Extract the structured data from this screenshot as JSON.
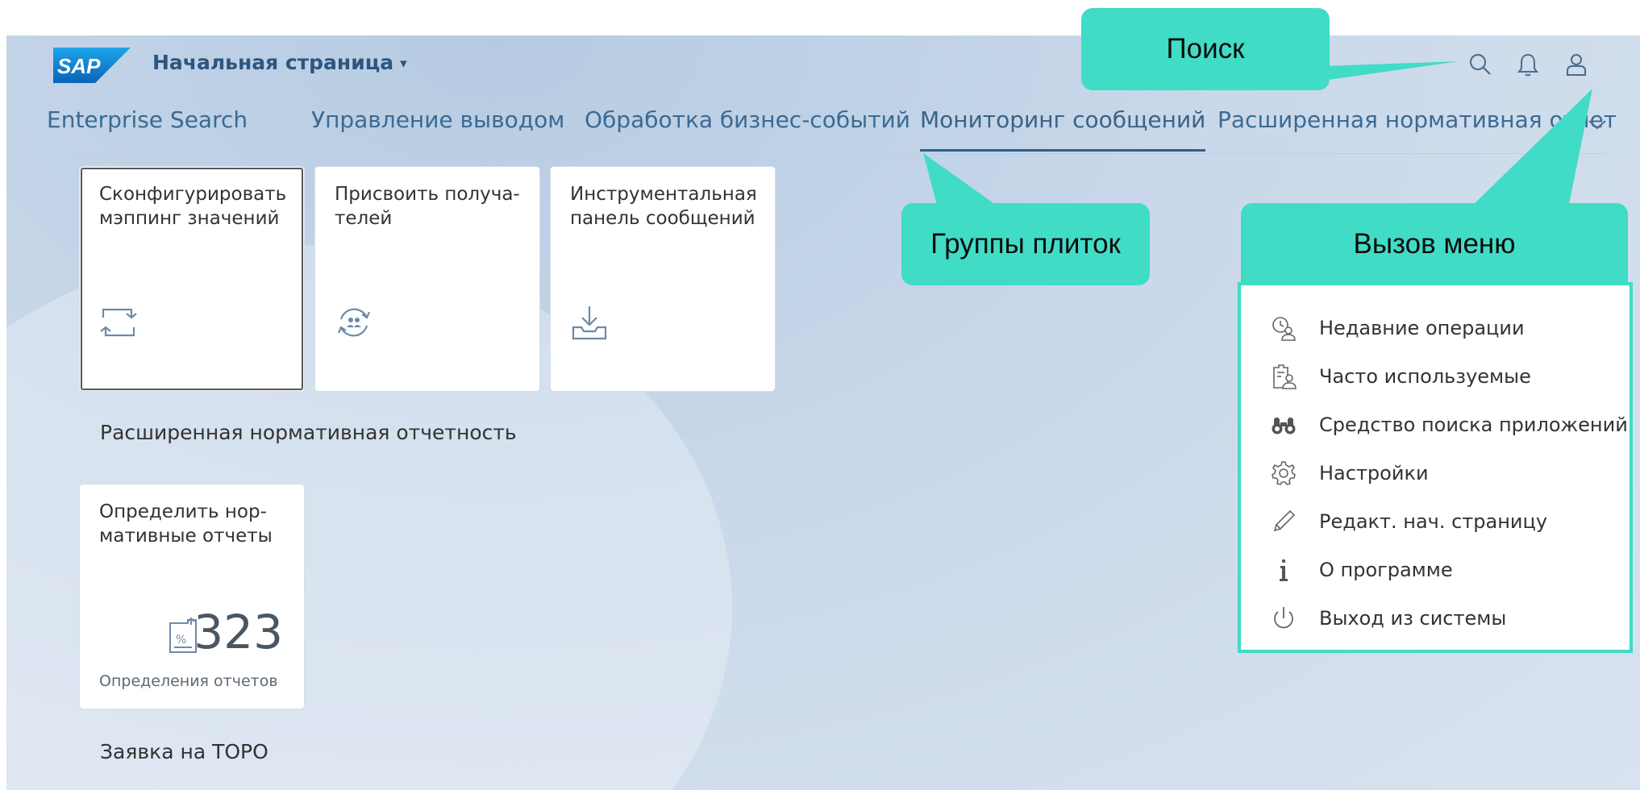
{
  "header": {
    "logo_text": "SAP",
    "title": "Начальная страница",
    "caret": "▾"
  },
  "tabs": [
    {
      "label": "Enterprise Search"
    },
    {
      "label": "Управление выводом"
    },
    {
      "label": "Обработка бизнес-событий"
    },
    {
      "label": "Мониторинг сообщений",
      "active": true
    },
    {
      "label": "Расширенная нормативная отчет"
    }
  ],
  "tiles": [
    {
      "title": "Сконфигурировать\nмэппинг значений",
      "icon": "mapping-icon"
    },
    {
      "title": "Присвоить получа-\nтелей",
      "icon": "assign-recipients-icon"
    },
    {
      "title": "Инструментальная\nпанель сообщений",
      "icon": "download-tray-icon"
    }
  ],
  "groups": [
    {
      "title": "Расширенная нормативная отчетность",
      "tile": {
        "title": "Определить нор-\nмативные отчеты",
        "kpi": "323",
        "footer": "Определения отчетов",
        "icon": "report-percent-icon"
      }
    },
    {
      "title": "Заявка на ТОРО"
    }
  ],
  "callouts": {
    "search": "Поиск",
    "tile_groups": "Группы плиток",
    "menu": "Вызов меню"
  },
  "menu": {
    "items": [
      {
        "label": "Недавние операции",
        "icon": "recent-activities-icon"
      },
      {
        "label": "Часто используемые",
        "icon": "frequently-used-icon"
      },
      {
        "label": "Средство поиска приложений",
        "icon": "binoculars-icon"
      },
      {
        "label": "Настройки",
        "icon": "gear-icon"
      },
      {
        "label": "Редакт. нач. страницу",
        "icon": "pencil-icon"
      },
      {
        "label": "О программе",
        "icon": "info-icon"
      },
      {
        "label": "Выход из системы",
        "icon": "power-icon"
      }
    ]
  },
  "colors": {
    "accent": "#40dcc6",
    "link": "#2b5680",
    "sap_blue": "#1a6fc9"
  }
}
